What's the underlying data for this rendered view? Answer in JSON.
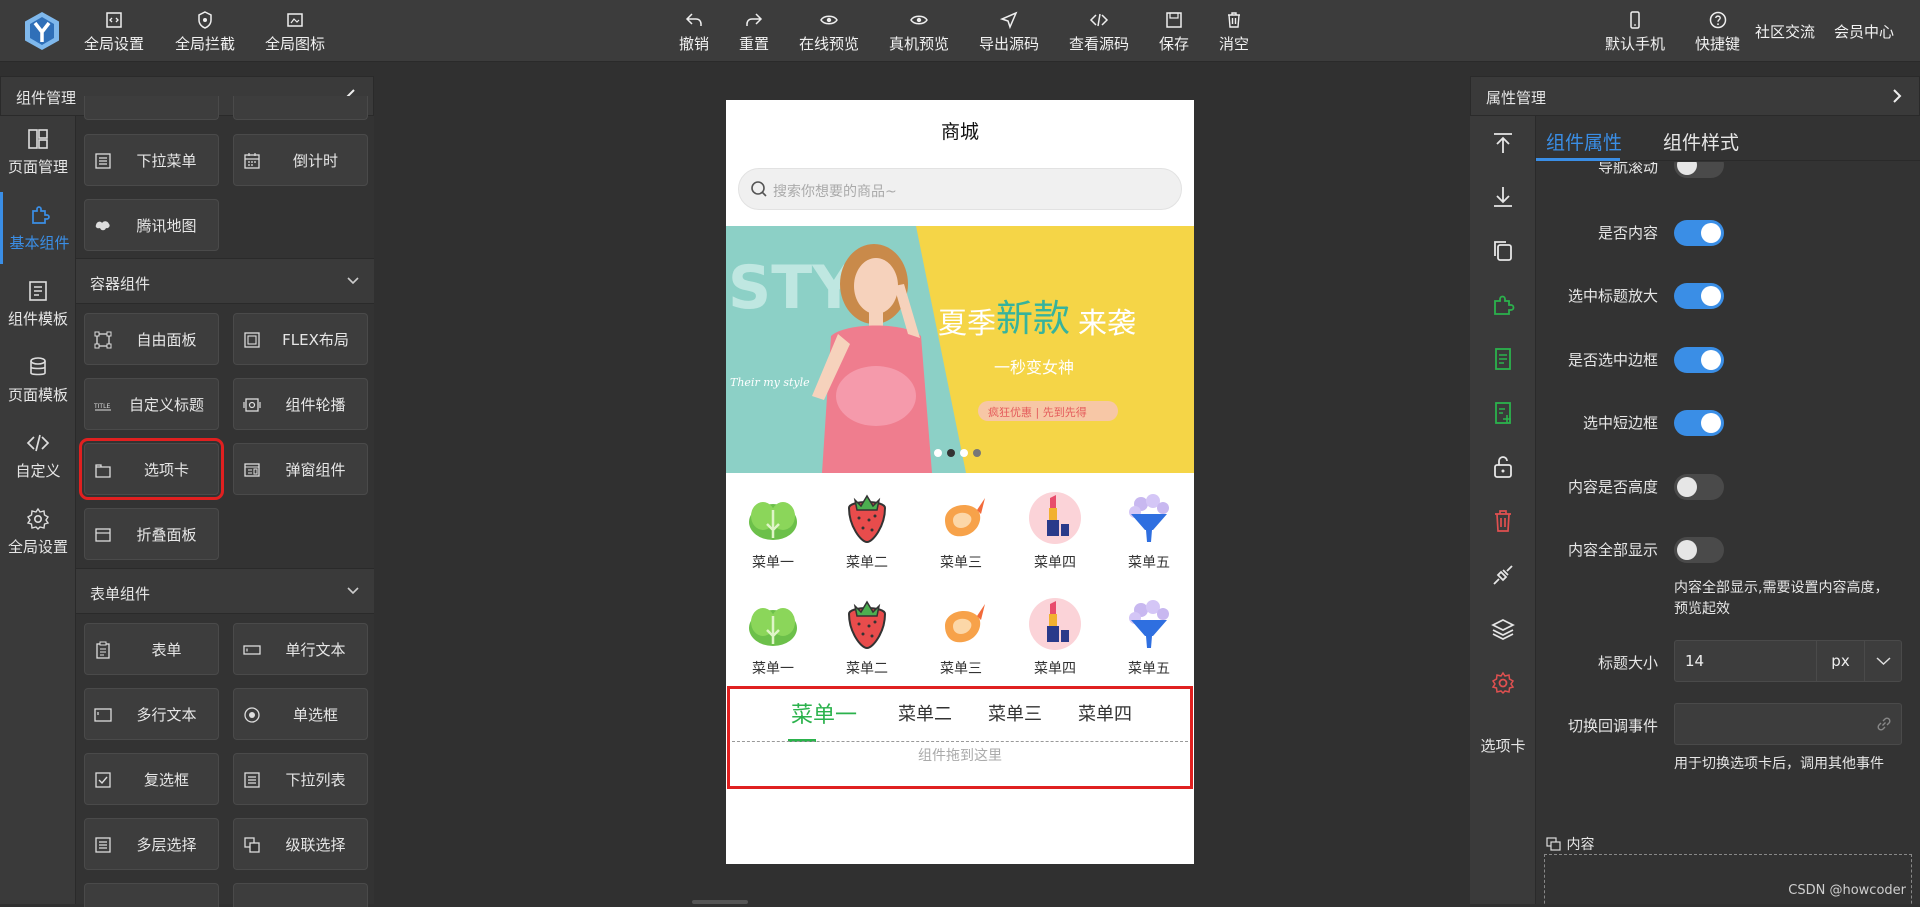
{
  "toolbar": {
    "left": [
      "全局设置",
      "全局拦截",
      "全局图标"
    ],
    "center": [
      "撤销",
      "重置",
      "在线预览",
      "真机预览",
      "导出源码",
      "查看源码",
      "保存",
      "消空"
    ],
    "right_icons": [
      "默认手机",
      "快捷键"
    ],
    "right_links": [
      "社区交流",
      "会员中心"
    ]
  },
  "left_panel": {
    "title": "组件管理",
    "nav": [
      "页面管理",
      "基本组件",
      "组件模板",
      "页面模板",
      "自定义",
      "全局设置"
    ],
    "active_nav": "基本组件",
    "basic": [
      "下拉菜单",
      "倒计时",
      "腾讯地图"
    ],
    "container_title": "容器组件",
    "container": [
      "自由面板",
      "FLEX布局",
      "自定义标题",
      "组件轮播",
      "选项卡",
      "弹窗组件",
      "折叠面板"
    ],
    "form_title": "表单组件",
    "form": [
      "表单",
      "单行文本",
      "多行文本",
      "单选框",
      "复选框",
      "下拉列表",
      "多层选择",
      "级联选择"
    ]
  },
  "phone": {
    "title": "商城",
    "search_placeholder": "搜索你想要的商品~",
    "banner": {
      "main": "夏季新款来袭",
      "main_parts": [
        "夏季",
        "新款",
        "来袭"
      ],
      "sub": "一秒变女神",
      "btn": "疯狂优惠 | 先到先得",
      "bg": "STY",
      "script": "Their my style"
    },
    "menus": [
      "菜单一",
      "菜单二",
      "菜单三",
      "菜单四",
      "菜单五"
    ],
    "tabs": [
      "菜单一",
      "菜单二",
      "菜单三",
      "菜单四"
    ],
    "drop_hint": "组件拖到这里"
  },
  "right_panel": {
    "title": "属性管理",
    "tabs": [
      "组件属性",
      "组件样式"
    ],
    "tool_label": "选项卡",
    "props": {
      "nav_scroll": "导航滚动",
      "has_content": "是否内容",
      "enlarge": "选中标题放大",
      "border": "是否选中边框",
      "short_border": "选中短边框",
      "content_height": "内容是否高度",
      "content_all": "内容全部显示",
      "content_all_hint": "内容全部显示,需要设置内容高度，预览起效",
      "title_size": "标题大小",
      "title_size_value": "14",
      "title_size_unit": "px",
      "switch_event": "切换回调事件",
      "switch_event_hint": "用于切换选项卡后，调用其他事件",
      "content": "内容"
    },
    "toggles": {
      "nav_scroll": false,
      "has_content": true,
      "enlarge": true,
      "border": true,
      "short_border": true,
      "content_height": false,
      "content_all": false
    }
  },
  "watermark": "CSDN @howcoder",
  "colors": {
    "accent": "#3a8ee6",
    "tab_active": "#2bb24c",
    "highlight": "#e02020",
    "danger": "#e05050",
    "green_icon": "#2bb24c"
  }
}
